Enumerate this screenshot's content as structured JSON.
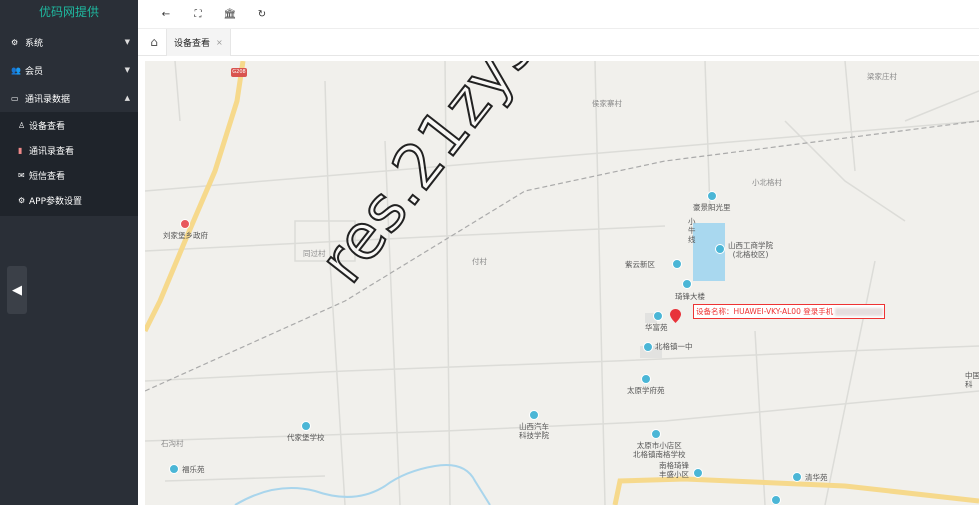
{
  "brand": "优码网提供",
  "sidebar": {
    "items": [
      {
        "label": "系统",
        "icon": "gear-icon"
      },
      {
        "label": "会员",
        "icon": "users-icon"
      },
      {
        "label": "通讯录数据",
        "icon": "id-card-icon"
      }
    ],
    "submenu": [
      {
        "label": "设备查看",
        "icon": "user-icon"
      },
      {
        "label": "通讯录查看",
        "icon": "address-book-icon"
      },
      {
        "label": "短信查看",
        "icon": "envelope-icon"
      },
      {
        "label": "APP参数设置",
        "icon": "gear-icon"
      }
    ]
  },
  "toolbar": {
    "buttons": [
      "back-icon",
      "fullscreen-icon",
      "bank-icon",
      "refresh-icon"
    ]
  },
  "tabs": {
    "home_icon": "home-icon",
    "active": "设备查看",
    "close": "×"
  },
  "map": {
    "route_badge": "G208",
    "device_label": "设备名称：HUAWEI-VKY-AL00 登录手机",
    "watermark": "res.21zys.com",
    "places": {
      "houjia": "侯家寨村",
      "liangjia": "梁家庄村",
      "xiaobei": "小北格村",
      "haojing": "豪景阳光里",
      "shangong": "山西工商学院\n(北格校区)",
      "liujia": "刘家堡乡政府",
      "tongguo": "同过村",
      "ziyun": "紫云新区",
      "qifeng": "琦锋大楼",
      "huafu": "华富苑",
      "beige": "北格镇一中",
      "taiyuan_xf": "太原学府苑",
      "zhongguo": "中国\n科",
      "shigou": "石沟村",
      "daijia": "代家堡学校",
      "shanxi_auto": "山西汽车\n科技学院",
      "xiaodian": "太原市小店区\n北格镇南格学校",
      "fule": "福乐苑",
      "nange": "南格琦锋\n丰盛小区",
      "qinghua": "清华苑",
      "xiaoniu": "小\n牛\n线",
      "fucun": "付村"
    }
  }
}
